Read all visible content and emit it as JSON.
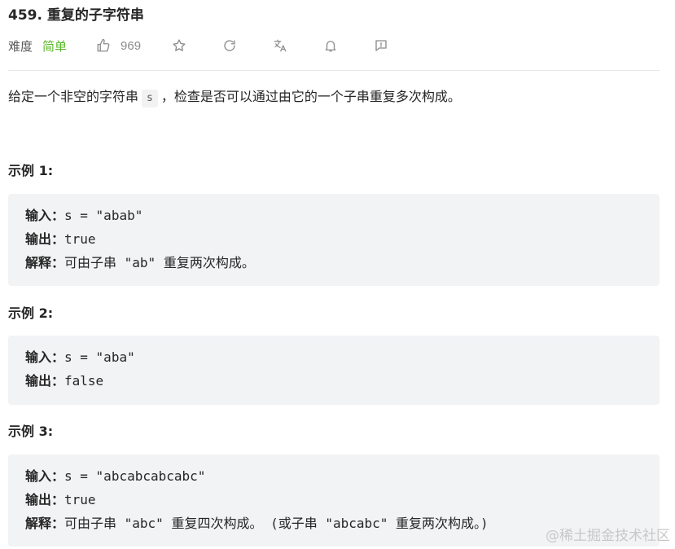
{
  "problem": {
    "number": "459.",
    "title": "重复的子字符串"
  },
  "meta": {
    "difficulty_label": "难度",
    "difficulty": "简单",
    "likes": "969",
    "icons": [
      "thumbs-up-icon",
      "star-icon",
      "refresh-icon",
      "translate-icon",
      "bell-icon",
      "feedback-icon"
    ],
    "difficulty_color": "#5ab726"
  },
  "description": {
    "before": "给定一个非空的字符串",
    "code": "s",
    "after": "，检查是否可以通过由它的一个子串重复多次构成。"
  },
  "examples": [
    {
      "title": "示例 1:",
      "lines": [
        {
          "key": "输入：",
          "value": "s = \"abab\""
        },
        {
          "key": "输出：",
          "value": "true"
        },
        {
          "key": "解释：",
          "value": "可由子串 \"ab\" 重复两次构成。"
        }
      ]
    },
    {
      "title": "示例 2:",
      "lines": [
        {
          "key": "输入：",
          "value": "s = \"aba\""
        },
        {
          "key": "输出：",
          "value": "false"
        }
      ]
    },
    {
      "title": "示例 3:",
      "lines": [
        {
          "key": "输入：",
          "value": "s = \"abcabcabcabc\""
        },
        {
          "key": "输出：",
          "value": "true"
        },
        {
          "key": "解释：",
          "value": "可由子串 \"abc\" 重复四次构成。 (或子串 \"abcabc\" 重复两次构成。)"
        }
      ]
    }
  ],
  "watermark": "@稀土掘金技术社区"
}
